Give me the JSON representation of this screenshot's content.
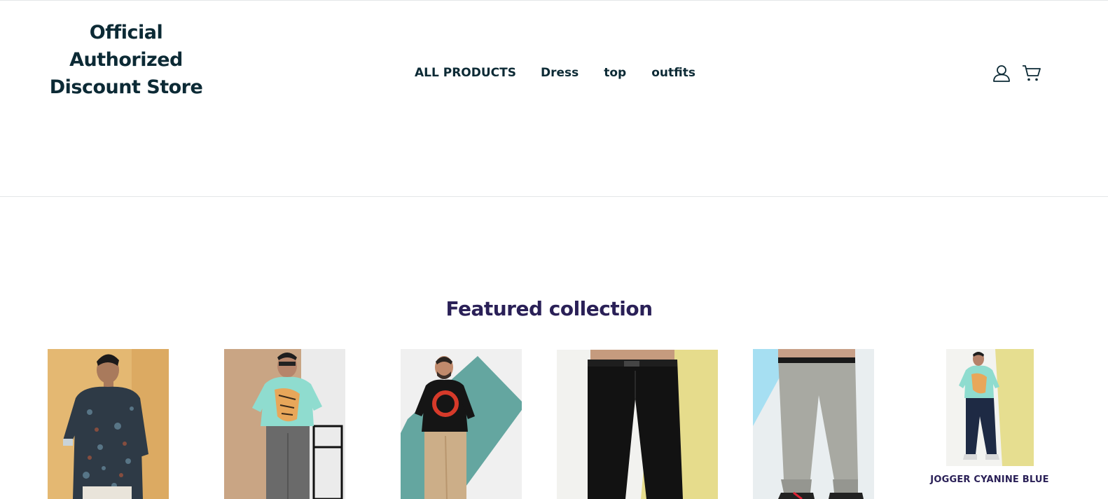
{
  "header": {
    "logo_text": "Official Authorized Discount Store",
    "nav": [
      {
        "label": "ALL PRODUCTS"
      },
      {
        "label": "Dress"
      },
      {
        "label": "top"
      },
      {
        "label": "outfits"
      }
    ],
    "icons": {
      "account": "user-icon",
      "cart": "cart-icon"
    }
  },
  "featured": {
    "title": "Featured collection",
    "products": [
      {
        "name": "",
        "image": "printed-shirt-photo"
      },
      {
        "name": "",
        "image": "tiger-tee-photo"
      },
      {
        "name": "",
        "image": "black-tee-photo"
      },
      {
        "name": "",
        "image": "black-trousers-photo"
      },
      {
        "name": "",
        "image": "grey-joggers-photo"
      },
      {
        "name": "JOGGER CYANINE BLUE",
        "image": "jogger-cyanine-photo"
      }
    ]
  },
  "colors": {
    "brand_text": "#0c2a35",
    "section_title": "#2a2057"
  }
}
